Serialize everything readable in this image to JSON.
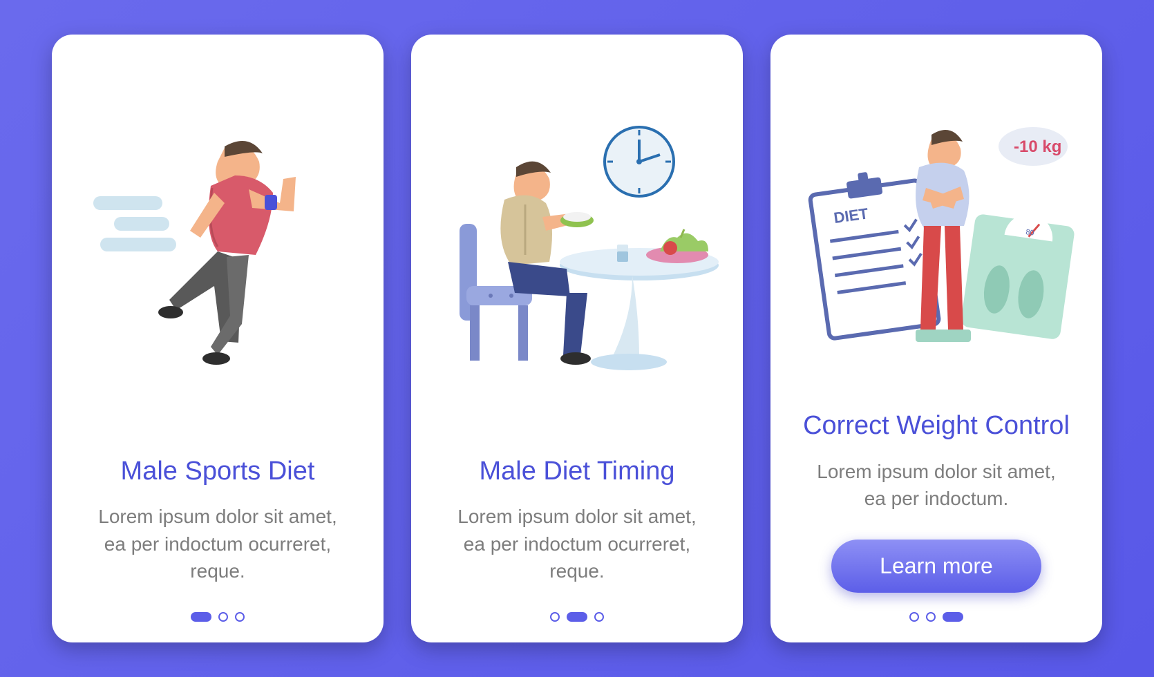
{
  "cards": [
    {
      "title": "Male Sports Diet",
      "desc": "Lorem ipsum dolor sit amet, ea per indoctum ocurreret, reque.",
      "activeIndex": 0
    },
    {
      "title": "Male Diet Timing",
      "desc": "Lorem ipsum dolor sit amet, ea per indoctum ocurreret, reque.",
      "activeIndex": 1
    },
    {
      "title": "Correct Weight Control",
      "desc": "Lorem ipsum dolor sit amet, ea per indoctum.",
      "activeIndex": 2,
      "cta": "Learn more",
      "badge": "-10 kg",
      "clipboardLabel": "DIET",
      "scaleValue": "80"
    }
  ]
}
